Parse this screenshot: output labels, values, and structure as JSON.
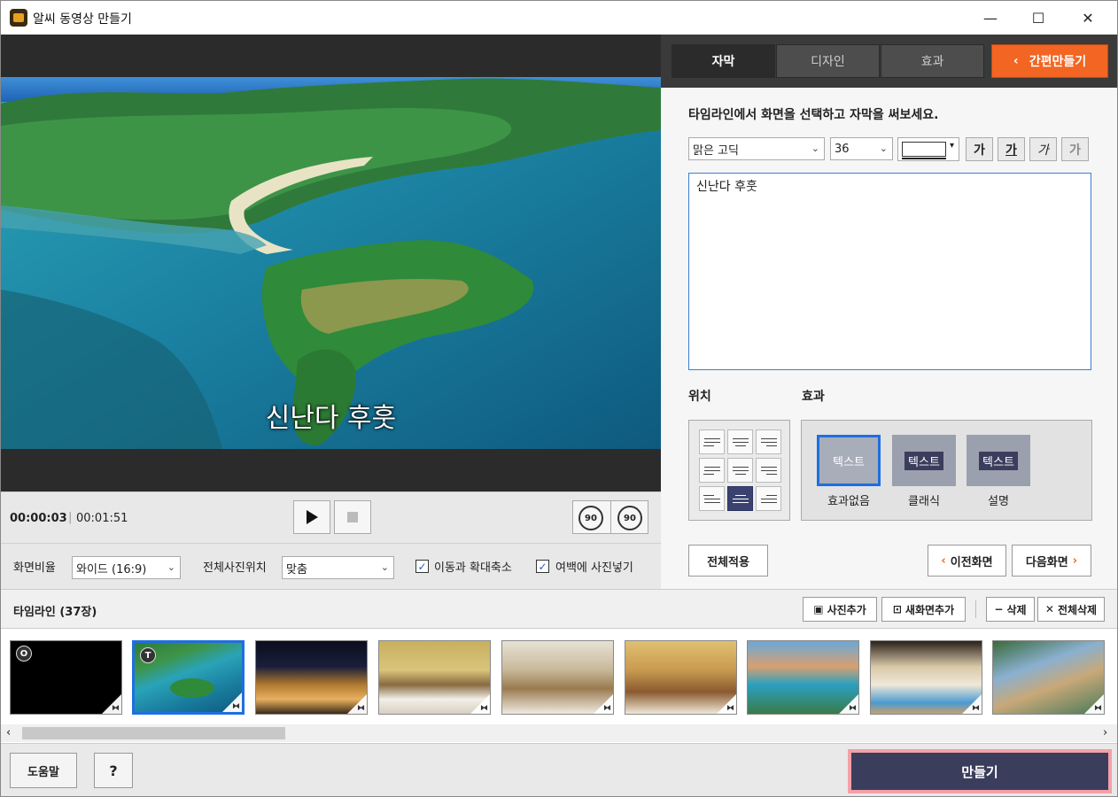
{
  "window": {
    "title": "알씨 동영상 만들기",
    "minimize": "—",
    "maximize": "☐",
    "close": "✕"
  },
  "preview": {
    "caption": "신난다 후훗"
  },
  "playback": {
    "current_time": "00:00:03",
    "total_time": "00:01:51",
    "rotate_left": "90",
    "rotate_right": "90"
  },
  "settings": {
    "ratio_label": "화면비율",
    "ratio_value": "와이드 (16:9)",
    "photo_pos_label": "전체사진위치",
    "photo_pos_value": "맞춤",
    "opt_motion": "이동과 확대축소",
    "opt_motion_checked": true,
    "opt_margin": "여백에 사진넣기",
    "opt_margin_checked": true
  },
  "tabs": [
    {
      "label": "자막",
      "active": true
    },
    {
      "label": "디자인",
      "active": false
    },
    {
      "label": "효과",
      "active": false
    }
  ],
  "quick_make": "간편만들기",
  "subtitle": {
    "instruction": "타임라인에서 화면을 선택하고 자막을 써보세요.",
    "font": "맑은 고딕",
    "size": "36",
    "format_buttons": [
      "가",
      "가",
      "가",
      "가"
    ],
    "text": "신난다 후훗",
    "position_label": "위치",
    "effect_label": "효과",
    "effects": [
      {
        "preview": "텍스트",
        "label": "효과없음",
        "selected": true
      },
      {
        "preview": "텍스트",
        "label": "클래식",
        "selected": false
      },
      {
        "preview": "텍스트",
        "label": "설명",
        "selected": false
      }
    ],
    "apply_all": "전체적용",
    "prev_screen": "이전화면",
    "next_screen": "다음화면",
    "selected_position": "bottom-center"
  },
  "timeline": {
    "label": "타임라인 (37장)",
    "add_photo": "사진추가",
    "add_screen": "새화면추가",
    "delete": "삭제",
    "delete_all": "전체삭제",
    "thumbs": [
      {
        "badge": "O",
        "kind": "blank"
      },
      {
        "badge": "T",
        "kind": "island",
        "selected": true
      },
      {
        "kind": "night"
      },
      {
        "kind": "room1"
      },
      {
        "kind": "bath"
      },
      {
        "kind": "room2"
      },
      {
        "kind": "pool"
      },
      {
        "kind": "room3"
      },
      {
        "kind": "villa"
      }
    ]
  },
  "footer": {
    "help": "도움말",
    "question": "?",
    "make": "만들기"
  },
  "colors": {
    "accent_orange": "#f26522",
    "make_button": "#3a3d5c",
    "selection_blue": "#1e6fe0"
  }
}
